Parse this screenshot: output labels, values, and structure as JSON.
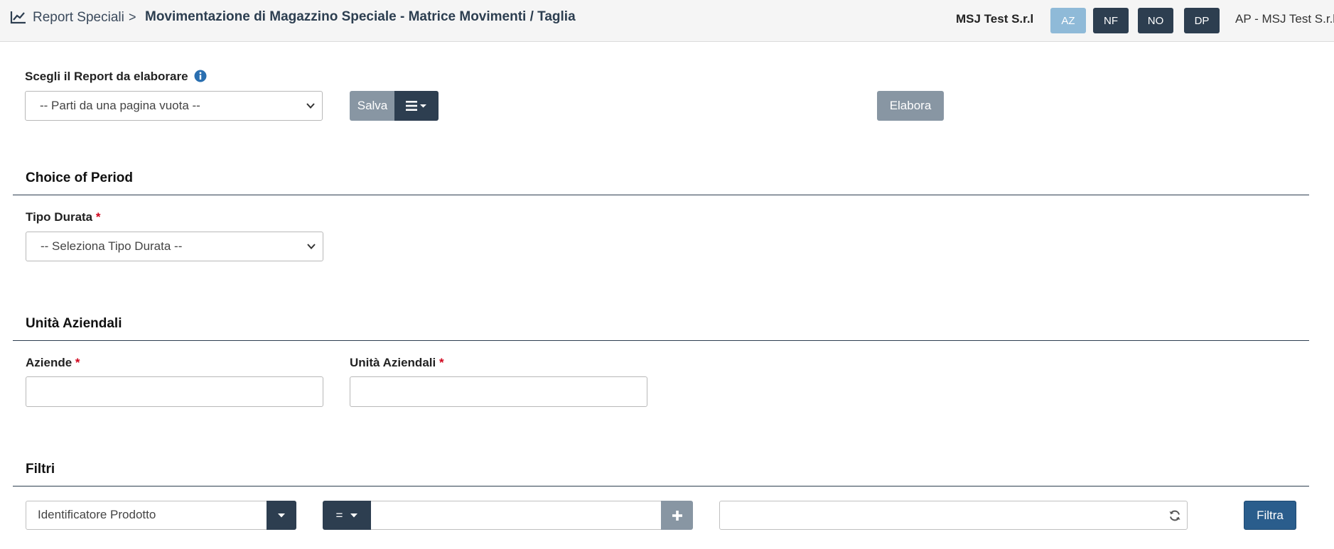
{
  "header": {
    "breadcrumb_root": "Report Speciali",
    "breadcrumb_separator": ">",
    "page_title": "Movimentazione di Magazzino Speciale - Matrice Movimenti / Taglia",
    "company": "MSJ Test S.r.l",
    "buttons": [
      {
        "label": "AZ",
        "active": true
      },
      {
        "label": "NF",
        "active": false
      },
      {
        "label": "NO",
        "active": false
      },
      {
        "label": "DP",
        "active": false
      }
    ],
    "user": "AP - MSJ Test S.r.l"
  },
  "report": {
    "label": "Scegli il Report da elaborare",
    "select_value": "-- Parti da una pagina vuota --",
    "save_label": "Salva",
    "elabora_label": "Elabora"
  },
  "period": {
    "section_title": "Choice of Period",
    "tipo_durata_label": "Tipo Durata",
    "required_mark": "*",
    "tipo_durata_value": "-- Seleziona Tipo Durata --"
  },
  "units": {
    "section_title": "Unità Aziendali",
    "aziende_label": "Aziende",
    "unita_label": "Unità Aziendali",
    "required_mark": "*"
  },
  "filters": {
    "section_title": "Filtri",
    "field_value": "Identificatore Prodotto",
    "operator": "=",
    "filtra_label": "Filtra"
  },
  "colors": {
    "dark": "#2d3e50",
    "muted": "#8896a3",
    "active": "#8fbad8",
    "primary": "#2a5d8c",
    "required": "#d0021b"
  },
  "icons": [
    "chart-line-icon",
    "info-icon",
    "chevron-down-icon",
    "hamburger-menu-icon",
    "caret-down-icon",
    "plus-icon",
    "refresh-icon"
  ]
}
